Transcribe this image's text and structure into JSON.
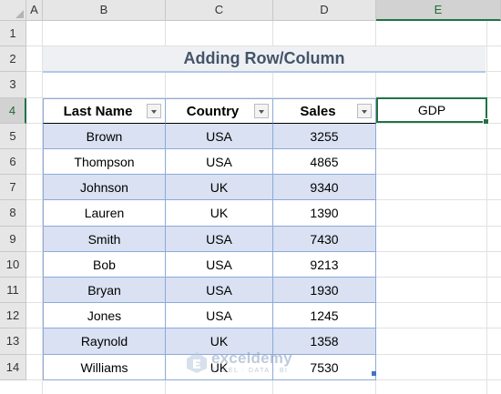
{
  "sheet": {
    "columns": [
      "A",
      "B",
      "C",
      "D",
      "E"
    ],
    "rows": [
      "1",
      "2",
      "3",
      "4",
      "5",
      "6",
      "7",
      "8",
      "9",
      "10",
      "11",
      "12",
      "13",
      "14"
    ],
    "selected_column": "E",
    "selected_row": "4"
  },
  "title": "Adding Row/Column",
  "table": {
    "headers": [
      "Last Name",
      "Country",
      "Sales"
    ],
    "rows": [
      [
        "Brown",
        "USA",
        "3255"
      ],
      [
        "Thompson",
        "USA",
        "4865"
      ],
      [
        "Johnson",
        "UK",
        "9340"
      ],
      [
        "Lauren",
        "UK",
        "1390"
      ],
      [
        "Smith",
        "USA",
        "7430"
      ],
      [
        "Bob",
        "USA",
        "9213"
      ],
      [
        "Bryan",
        "USA",
        "1930"
      ],
      [
        "Jones",
        "USA",
        "1245"
      ],
      [
        "Raynold",
        "UK",
        "1358"
      ],
      [
        "Williams",
        "UK",
        "7530"
      ]
    ]
  },
  "active_cell": {
    "ref": "E4",
    "value": "GDP"
  },
  "watermark": {
    "name": "exceldemy",
    "tagline": "EXCEL · DATA · BI"
  },
  "colors": {
    "band": "#d9e1f2",
    "accent": "#217346",
    "table_border": "#8ea9db"
  }
}
